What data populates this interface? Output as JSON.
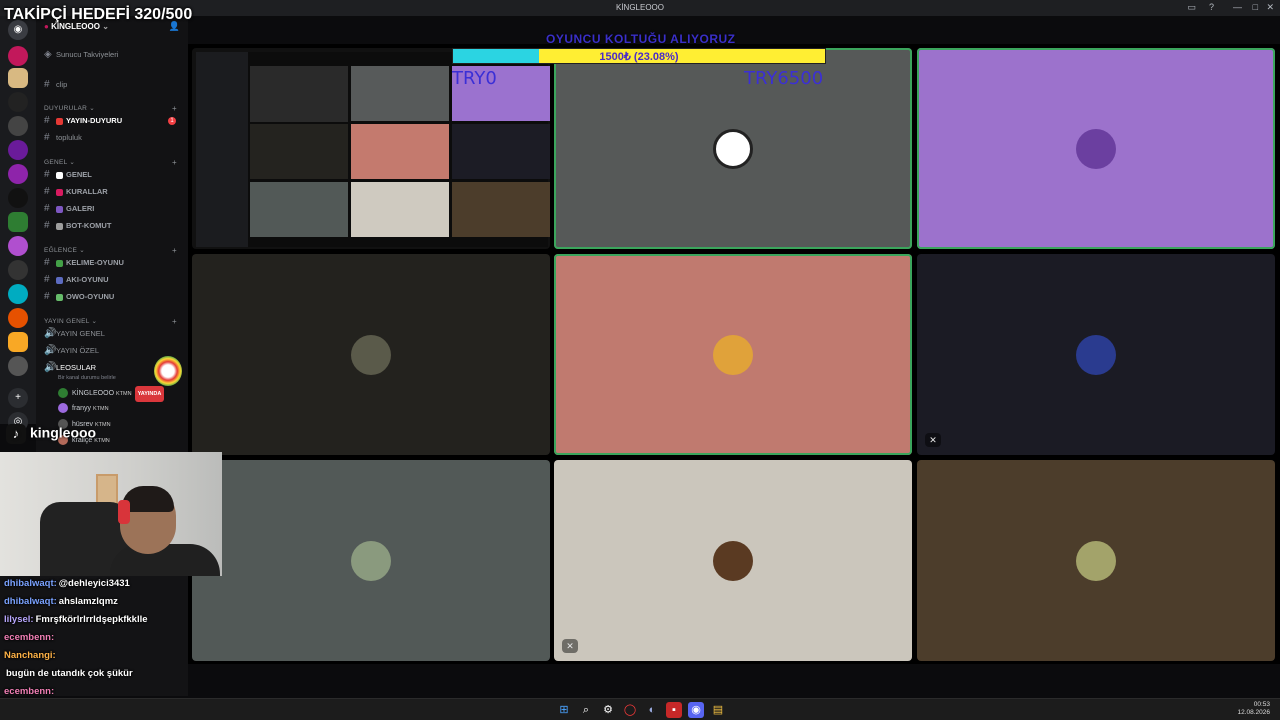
{
  "window": {
    "title": "KİNGLEOOO"
  },
  "overlay": {
    "follow_goal": "TAKİPÇİ HEDEFİ 320/500",
    "donation_title": "OYUNCU KOLTUĞU ALIYORUZ",
    "donation_amount": "1500₺ (23.08%)",
    "donation_progress_pct": 23.08,
    "try_left": "TRY0",
    "try_right": "TRY6500",
    "tiktok_user": "kingleooo"
  },
  "sidebar": {
    "server_name": "KİNGLEOOO",
    "boosts": "Sunucu Takviyeleri",
    "clip": "clip",
    "categories": {
      "duyurular": "DUYURULAR",
      "genel": "GENEL",
      "eglence": "EĞLENCE",
      "yayin_genel": "YAYIN GENEL"
    },
    "channels": {
      "yayin_duyuru": "YAYIN-DUYURU",
      "topluluk": "topluluk",
      "genel": "GENEL",
      "kurallar": "KURALLAR",
      "galeri": "GALERI",
      "bot_komut": "BOT-KOMUT",
      "kelime_oyunu": "KELIME-OYUNU",
      "aki_oyunu": "AKI-OYUNU",
      "owo_oyunu": "OWO-OYUNU",
      "yayin_genel": "YAYIN GENEL",
      "yayin_ozel": "YAYIN ÖZEL",
      "leosular": "LEOSULAR"
    },
    "status_hint": "Bir kanal durumu belirle",
    "voice_users": [
      {
        "name": "KİNGLEOOO",
        "tag": "KTMN",
        "live": "YAYINDA"
      },
      {
        "name": "franyy",
        "tag": "KTMN"
      },
      {
        "name": "hüsrev",
        "tag": "KTMN"
      },
      {
        "name": "kraliçe",
        "tag": "KTMN"
      }
    ]
  },
  "chat": [
    {
      "user": "dhibalwaqt:",
      "text": "@dehleyici3431",
      "color": "#7aa2ff"
    },
    {
      "user": "dhibalwaqt:",
      "text": "ahslamzlqmz",
      "color": "#7aa2ff"
    },
    {
      "user": "lilysel:",
      "text": "Fmrşfkörlrlrrldşepkfkklle",
      "color": "#b9a8ff"
    },
    {
      "user": "ecembenn:",
      "text": "",
      "color": "#f07fb5"
    },
    {
      "user": "Nanchangi:",
      "text": "",
      "color": "#ffb347"
    },
    {
      "user": "",
      "text": "bugün de utandık çok şükür",
      "color": "#ffffff"
    },
    {
      "user": "ecembenn:",
      "text": "",
      "color": "#f07fb5"
    },
    {
      "user": "ecembenn:",
      "text": "",
      "color": "#f07fb5"
    }
  ],
  "tray": {
    "time": "00:53",
    "date": "12.08.2026"
  }
}
